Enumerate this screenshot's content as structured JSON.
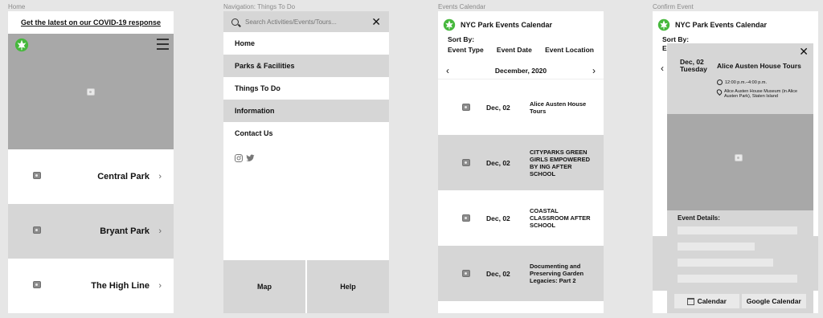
{
  "frames": {
    "home": {
      "title": "Home",
      "banner": "Get the latest on our COVID-19 response",
      "parks": [
        "Central Park",
        "Bryant Park",
        "The High Line"
      ]
    },
    "nav": {
      "title": "Navigation: Things To Do",
      "search_placeholder": "Search Activities/Events/Tours...",
      "items": [
        "Home",
        "Parks & Facilities",
        "Things To Do",
        "Information",
        "Contact Us"
      ],
      "tabs": [
        "Map",
        "Help"
      ]
    },
    "calendar": {
      "title": "Events Calendar",
      "app_title": "NYC Park Events Calendar",
      "sort_by": "Sort By:",
      "sort_options": [
        "Event Type",
        "Event Date",
        "Event Location"
      ],
      "month": "December, 2020",
      "events": [
        {
          "date": "Dec, 02",
          "title": "Alice Austen House Tours"
        },
        {
          "date": "Dec, 02",
          "title": "CITYPARKS GREEN GIRLS EMPOWERED BY ING AFTER SCHOOL"
        },
        {
          "date": "Dec, 02",
          "title": "COASTAL CLASSROOM AFTER SCHOOL"
        },
        {
          "date": "Dec, 02",
          "title": "Documenting and Preserving Garden Legacies: Part 2"
        }
      ]
    },
    "confirm": {
      "title": "Confirm Event",
      "app_title": "NYC Park Events Calendar",
      "sort_by": "Sort By:",
      "sort_partial": "E",
      "date_line1": "Dec, 02",
      "date_line2": "Tuesday",
      "event_title": "Alice Austen House Tours",
      "time": "12:00 p.m.–4:00 p.m.",
      "location": "Alice Austen House Museum (in Alice Austen Park), Staten Island",
      "details_label": "Event Details:",
      "actions": [
        "Calendar",
        "Google Calendar"
      ]
    }
  },
  "colors": {
    "brand_green": "#46b83c",
    "gray_light": "#d6d6d6",
    "gray_dark": "#a8a8a8"
  }
}
